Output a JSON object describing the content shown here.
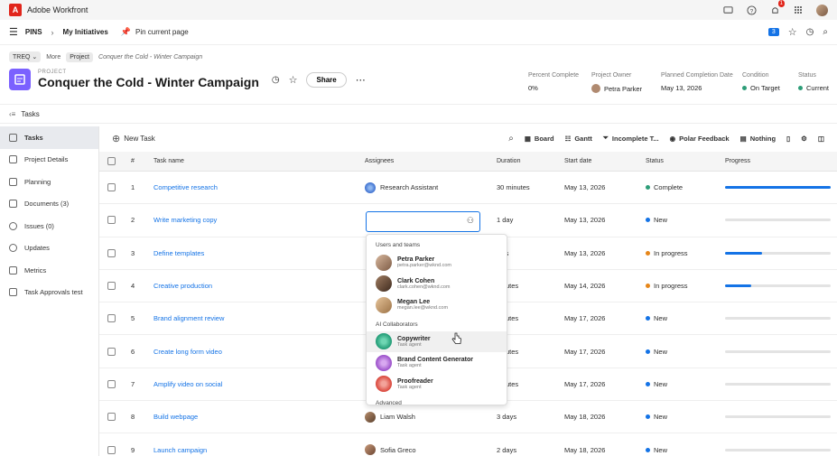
{
  "app": {
    "name": "Adobe Workfront",
    "notification_count": "1"
  },
  "pinbar": {
    "pins": "PINS",
    "my_initiatives": "My Initiatives",
    "pin_current": "Pin current page",
    "count": "3"
  },
  "breadcrumb": {
    "treq": "TREQ",
    "more": "More",
    "project": "Project",
    "path": "Conquer the Cold - Winter Campaign"
  },
  "project": {
    "label": "PROJECT",
    "title": "Conquer the Cold - Winter Campaign",
    "share": "Share"
  },
  "meta": {
    "percent_complete": {
      "label": "Percent Complete",
      "value": "0%"
    },
    "owner": {
      "label": "Project Owner",
      "value": "Petra Parker"
    },
    "planned_completion": {
      "label": "Planned Completion Date",
      "value": "May 13, 2026"
    },
    "condition": {
      "label": "Condition",
      "value": "On Target"
    },
    "status": {
      "label": "Status",
      "value": "Current"
    }
  },
  "tasks_header": "Tasks",
  "sidebar": [
    {
      "label": "Tasks"
    },
    {
      "label": "Project Details"
    },
    {
      "label": "Planning"
    },
    {
      "label": "Documents (3)"
    },
    {
      "label": "Issues (0)"
    },
    {
      "label": "Updates"
    },
    {
      "label": "Metrics"
    },
    {
      "label": "Task Approvals test"
    }
  ],
  "toolbar": {
    "new_task": "New Task",
    "board": "Board",
    "gantt": "Gantt",
    "incomplete": "Incomplete T...",
    "polar": "Polar Feedback",
    "nothing": "Nothing"
  },
  "columns": {
    "num": "#",
    "name": "Task name",
    "assignees": "Assignees",
    "duration": "Duration",
    "start": "Start date",
    "status": "Status",
    "progress": "Progress"
  },
  "rows": [
    {
      "num": "1",
      "name": "Competitive research",
      "assignee": "Research Assistant",
      "duration": "30 minutes",
      "start": "May 13, 2026",
      "status": "Complete",
      "progress": 1.0
    },
    {
      "num": "2",
      "name": "Write marketing copy",
      "assignee": "",
      "duration": "1 day",
      "start": "May 13, 2026",
      "status": "New",
      "progress": 0
    },
    {
      "num": "3",
      "name": "Define templates",
      "assignee": "",
      "duration": "lays",
      "start": "May 13, 2026",
      "status": "In progress",
      "progress": 0.35
    },
    {
      "num": "4",
      "name": "Creative production",
      "assignee": "",
      "duration": "ninutes",
      "start": "May 14, 2026",
      "status": "In progress",
      "progress": 0.25
    },
    {
      "num": "5",
      "name": "Brand alignment review",
      "assignee": "",
      "duration": "ninutes",
      "start": "May 17, 2026",
      "status": "New",
      "progress": 0
    },
    {
      "num": "6",
      "name": "Create long form video",
      "assignee": "",
      "duration": "ninutes",
      "start": "May 17, 2026",
      "status": "New",
      "progress": 0
    },
    {
      "num": "7",
      "name": "Amplify video on social",
      "assignee": "",
      "duration": "ninutes",
      "start": "May 17, 2026",
      "status": "New",
      "progress": 0
    },
    {
      "num": "8",
      "name": "Build webpage",
      "assignee": "Liam Walsh",
      "duration": "3 days",
      "start": "May 18, 2026",
      "status": "New",
      "progress": 0
    },
    {
      "num": "9",
      "name": "Launch campaign",
      "assignee": "Sofia Greco",
      "duration": "2 days",
      "start": "May 18, 2026",
      "status": "New",
      "progress": 0
    }
  ],
  "dropdown": {
    "users_title": "Users and teams",
    "users": [
      {
        "name": "Petra Parker",
        "sub": "petra.parker@wknd.com"
      },
      {
        "name": "Clark Cohen",
        "sub": "clark.cohen@wknd.com"
      },
      {
        "name": "Megan Lee",
        "sub": "megan.lee@wknd.com"
      }
    ],
    "ai_title": "AI Collaborators",
    "ai": [
      {
        "name": "Copywriter",
        "sub": "Task agent"
      },
      {
        "name": "Brand Content Generator",
        "sub": "Task agent"
      },
      {
        "name": "Proofreader",
        "sub": "Task agent"
      }
    ],
    "advanced": "Advanced"
  },
  "colors": {
    "accent": "#1473e6",
    "complete": "#2d9d78",
    "new": "#1473e6",
    "in_progress": "#e68619",
    "project_icon": "#7b61ff"
  }
}
